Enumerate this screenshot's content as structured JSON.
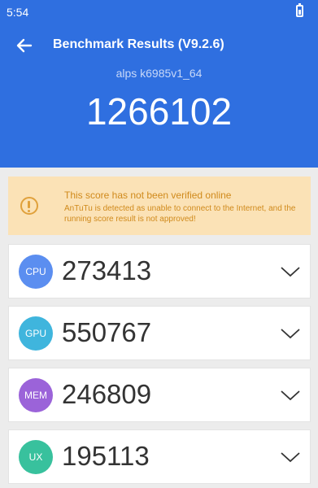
{
  "status": {
    "time": "5:54"
  },
  "header": {
    "title": "Benchmark Results (V9.2.6)",
    "device": "alps k6985v1_64",
    "total_score": "1266102"
  },
  "warning": {
    "title": "This score has not been verified online",
    "body": "AnTuTu is detected as unable to connect to the Internet, and the running score result is not approved!"
  },
  "cards": [
    {
      "label": "CPU",
      "score": "273413",
      "color": "#5b8ef0"
    },
    {
      "label": "GPU",
      "score": "550767",
      "color": "#3fb5dd"
    },
    {
      "label": "MEM",
      "score": "246809",
      "color": "#9b63d9"
    },
    {
      "label": "UX",
      "score": "195113",
      "color": "#38c19d"
    }
  ]
}
